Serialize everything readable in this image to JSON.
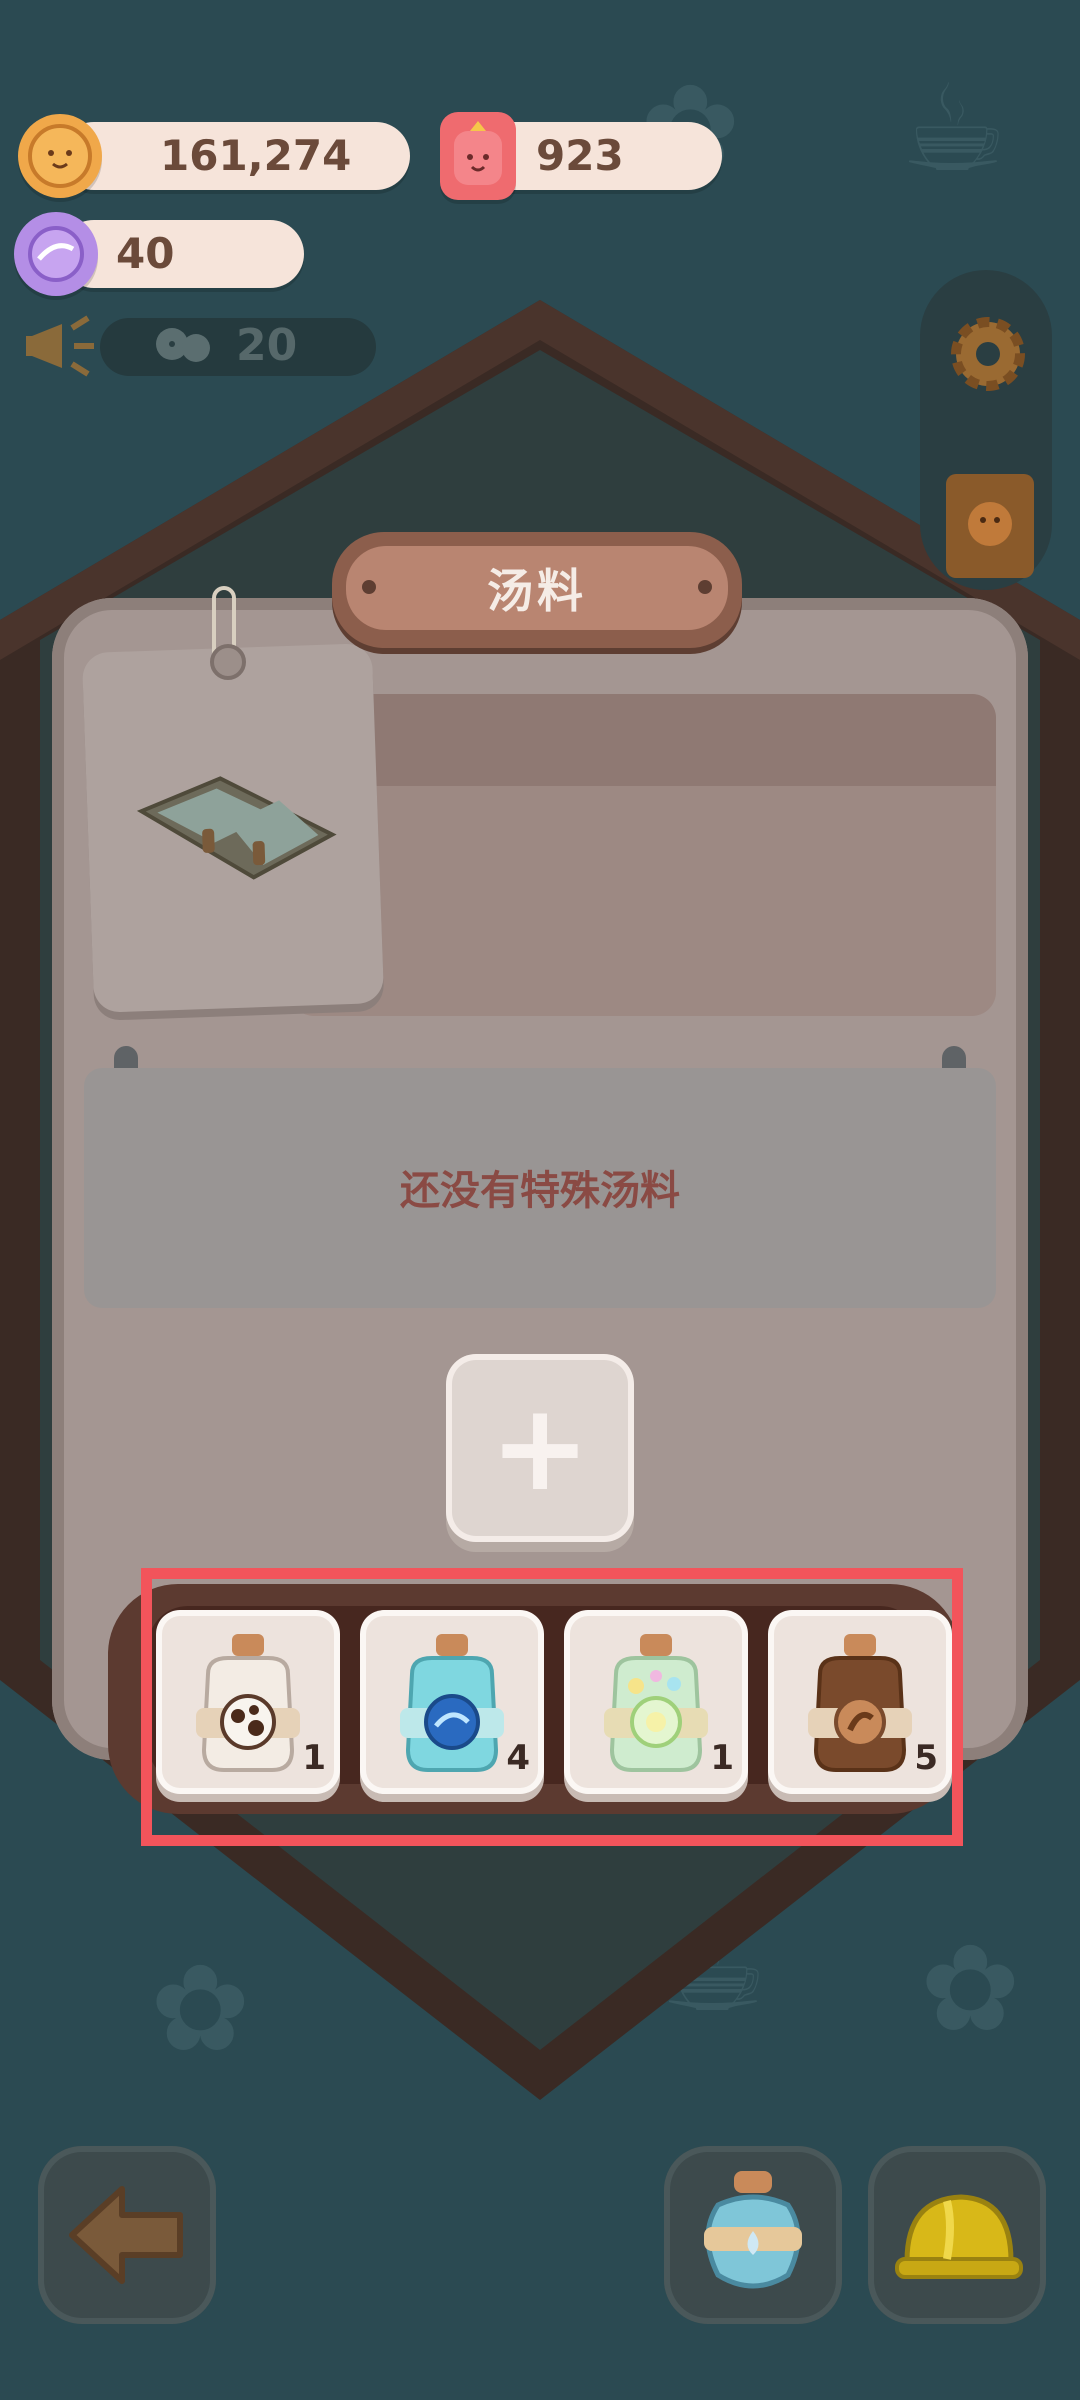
{
  "hud": {
    "coins": "161,274",
    "gems": "923",
    "candy": "40",
    "announcement_count": "20"
  },
  "dialog": {
    "title": "汤料",
    "empty_message": "还没有特殊汤料",
    "add_label": "+"
  },
  "inventory": [
    {
      "name": "cow-spot-soup-jar",
      "count": "1",
      "color": "#f3ece4",
      "band": "#e6d2b8"
    },
    {
      "name": "ocean-soup-jar",
      "count": "4",
      "color": "#7fd7e0",
      "band": "#bde8ea"
    },
    {
      "name": "sparkle-soup-jar",
      "count": "1",
      "color": "#cfeccf",
      "band": "#e7dcb4"
    },
    {
      "name": "chocolate-soup-jar",
      "count": "5",
      "color": "#7a4a2c",
      "band": "#e6d2b8"
    }
  ],
  "colors": {
    "background": "#2b4a52",
    "highlight": "#f2545b",
    "text_brown": "#6b4a3a"
  }
}
